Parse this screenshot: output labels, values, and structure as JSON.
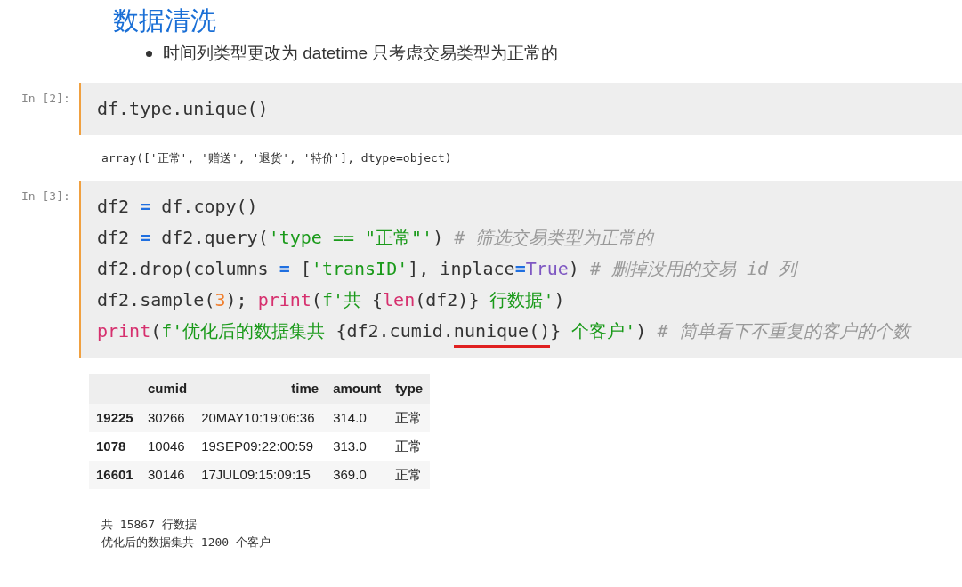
{
  "heading": "数据清洗",
  "bullets": [
    "时间列类型更改为 datetime 只考虑交易类型为正常的"
  ],
  "cells": [
    {
      "prompt": "In [2]:",
      "lines": [
        [
          {
            "kind": "plain",
            "text": "df.type.unique()"
          }
        ]
      ],
      "output": {
        "kind": "text",
        "lines": [
          "array(['正常', '赠送', '退货', '特价'], dtype=object)"
        ]
      }
    },
    {
      "prompt": "In [3]:",
      "lines": [
        [
          {
            "kind": "plain",
            "text": "df2 "
          },
          {
            "kind": "op",
            "text": "="
          },
          {
            "kind": "plain",
            "text": " df.copy()"
          }
        ],
        [
          {
            "kind": "plain",
            "text": "df2 "
          },
          {
            "kind": "op",
            "text": "="
          },
          {
            "kind": "plain",
            "text": " df2.query("
          },
          {
            "kind": "str",
            "text": "'type == \"正常\"'"
          },
          {
            "kind": "plain",
            "text": ") "
          },
          {
            "kind": "comment",
            "text": "# 筛选交易类型为正常的"
          }
        ],
        [
          {
            "kind": "plain",
            "text": "df2.drop(columns "
          },
          {
            "kind": "op",
            "text": "="
          },
          {
            "kind": "plain",
            "text": " ["
          },
          {
            "kind": "str",
            "text": "'transID'"
          },
          {
            "kind": "plain",
            "text": "], inplace"
          },
          {
            "kind": "op",
            "text": "="
          },
          {
            "kind": "kw",
            "text": "True"
          },
          {
            "kind": "plain",
            "text": ") "
          },
          {
            "kind": "comment",
            "text": "# 删掉没用的交易 id 列"
          }
        ],
        [
          {
            "kind": "plain",
            "text": "df2.sample("
          },
          {
            "kind": "num",
            "text": "3"
          },
          {
            "kind": "plain",
            "text": "); "
          },
          {
            "kind": "builtin",
            "text": "print"
          },
          {
            "kind": "plain",
            "text": "("
          },
          {
            "kind": "str",
            "text": "f'共 "
          },
          {
            "kind": "plain",
            "text": "{"
          },
          {
            "kind": "builtin",
            "text": "len"
          },
          {
            "kind": "plain",
            "text": "(df2)}"
          },
          {
            "kind": "str",
            "text": " 行数据'"
          },
          {
            "kind": "plain",
            "text": ")"
          }
        ],
        [
          {
            "kind": "builtin",
            "text": "print"
          },
          {
            "kind": "plain",
            "text": "("
          },
          {
            "kind": "str",
            "text": "f'优化后的数据集共 "
          },
          {
            "kind": "plain",
            "text": "{df2.cumid."
          },
          {
            "kind": "plain",
            "text": "nunique()",
            "underlined": true
          },
          {
            "kind": "plain",
            "text": "}"
          },
          {
            "kind": "str",
            "text": " 个客户'"
          },
          {
            "kind": "plain",
            "text": ") "
          },
          {
            "kind": "comment",
            "text": "# 简单看下不重复的客户的个数"
          }
        ]
      ],
      "output": {
        "kind": "table",
        "columns": [
          "",
          "cumid",
          "time",
          "amount",
          "type"
        ],
        "rows": [
          [
            "19225",
            "30266",
            "20MAY10:19:06:36",
            "314.0",
            "正常"
          ],
          [
            "1078",
            "10046",
            "19SEP09:22:00:59",
            "313.0",
            "正常"
          ],
          [
            "16601",
            "30146",
            "17JUL09:15:09:15",
            "369.0",
            "正常"
          ]
        ],
        "stdout": [
          "共 15867 行数据",
          "优化后的数据集共 1200 个客户"
        ]
      }
    }
  ]
}
